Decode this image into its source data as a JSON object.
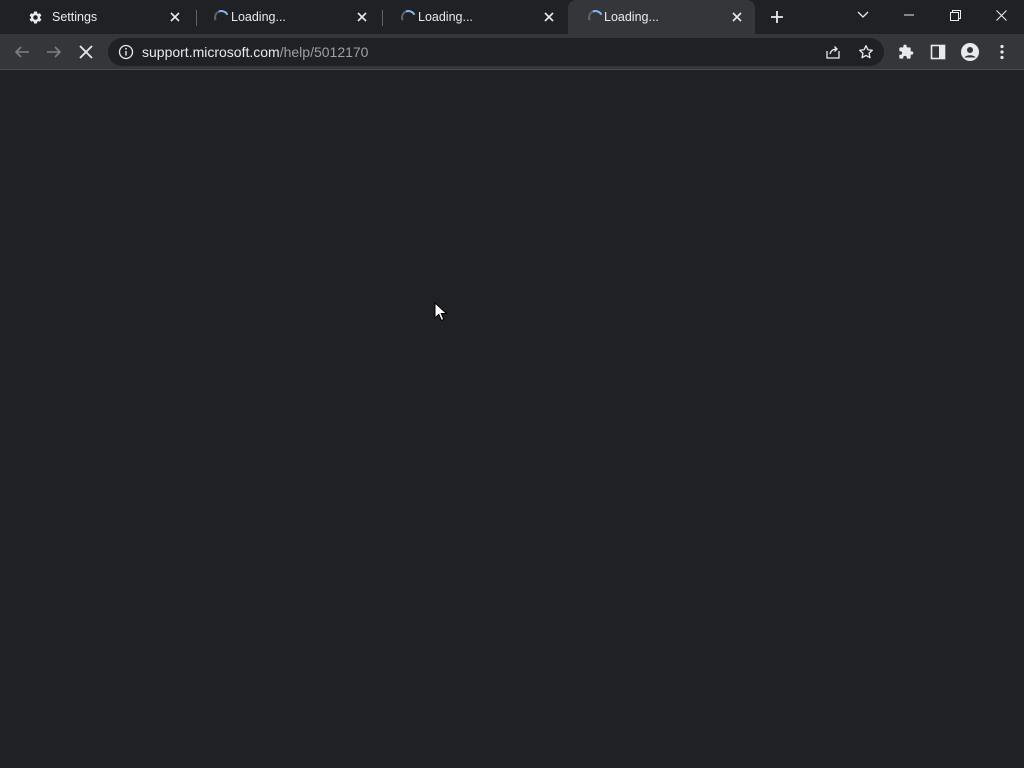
{
  "tabs": [
    {
      "title": "Settings",
      "icon": "gear-icon",
      "state": "loaded"
    },
    {
      "title": "Loading...",
      "icon": "loading-spinner-icon",
      "state": "loading"
    },
    {
      "title": "Loading...",
      "icon": "loading-spinner-icon",
      "state": "loading"
    },
    {
      "title": "Loading...",
      "icon": "loading-spinner-icon",
      "state": "loading",
      "active": true
    }
  ],
  "address_bar": {
    "url_host": "support.microsoft.com",
    "url_path": "/help/5012170"
  },
  "navigation": {
    "back": "arrow-left-icon",
    "forward": "arrow-right-icon",
    "stop": "stop-loading-icon"
  },
  "colors": {
    "background": "#202124",
    "toolbar": "#35363a",
    "text": "#e8eaed",
    "muted_text": "#9aa0a6"
  }
}
